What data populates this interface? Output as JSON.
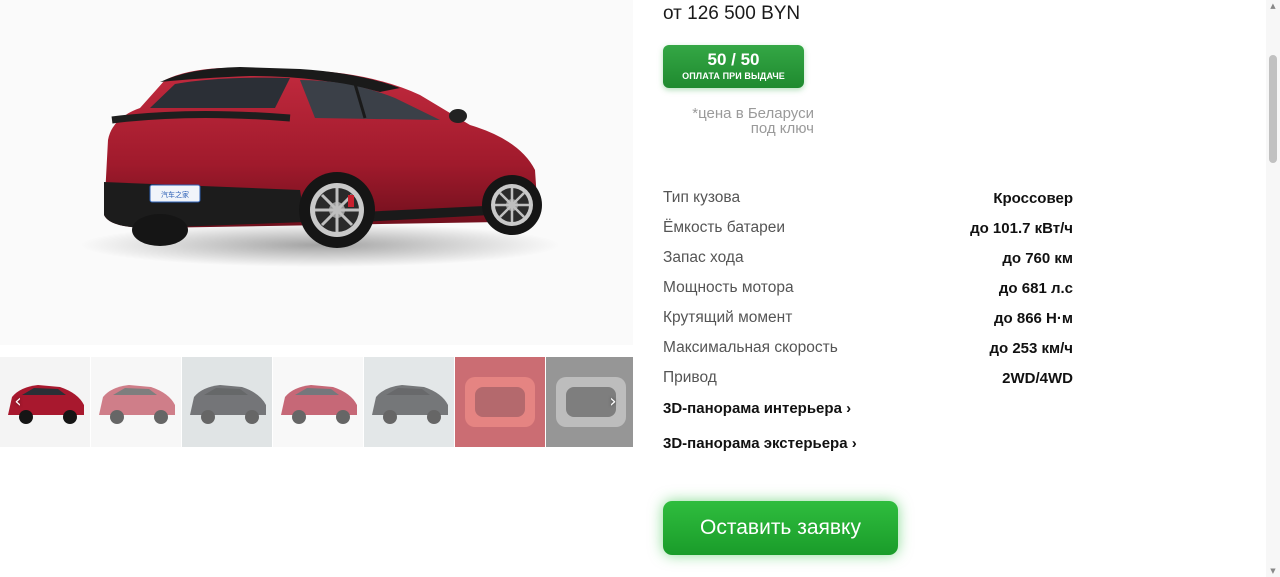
{
  "gallery": {
    "thumbnails": [
      {
        "name": "thumb-red-rear",
        "active": true
      },
      {
        "name": "thumb-red-rear-2",
        "active": false
      },
      {
        "name": "thumb-black-showroom",
        "active": false
      },
      {
        "name": "thumb-red-side",
        "active": false
      },
      {
        "name": "thumb-black-side",
        "active": false
      },
      {
        "name": "thumb-interior-red",
        "active": false
      },
      {
        "name": "thumb-interior-grey",
        "active": false
      }
    ],
    "prev_icon": "‹",
    "next_icon": "›",
    "plate_text": "汽车之家"
  },
  "product": {
    "price": "от 126 500 BYN",
    "badge_top": "50 / 50",
    "badge_bottom": "ОПЛАТА ПРИ ВЫДАЧЕ",
    "note_line1": "*цена в Беларуси",
    "note_line2": "под ключ"
  },
  "specs": [
    {
      "label": "Тип кузова",
      "value": "Кроссовер"
    },
    {
      "label": "Ёмкость батареи",
      "value": "до 101.7 кВт/ч"
    },
    {
      "label": "Запас хода",
      "value": "до 760 км"
    },
    {
      "label": "Мощность мотора",
      "value": "до 681 л.с"
    },
    {
      "label": "Крутящий момент",
      "value": "до 866 Н·м"
    },
    {
      "label": "Максимальная скорость",
      "value": "до 253 км/ч"
    },
    {
      "label": "Привод",
      "value": "2WD/4WD"
    }
  ],
  "links": {
    "interior": "3D-панорама интерьера ›",
    "exterior": "3D-панорама экстерьера ›"
  },
  "cta": {
    "label": "Оставить заявку"
  },
  "colors": {
    "accent_green": "#22a833",
    "car_red": "#a8182e"
  }
}
